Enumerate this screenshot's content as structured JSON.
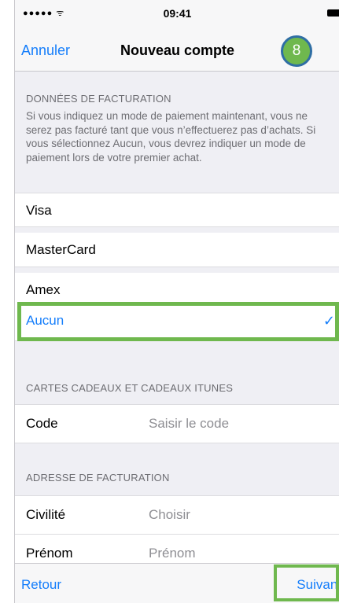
{
  "status_bar": {
    "signal": "●●●●● ᯤ",
    "time": "09:41"
  },
  "nav": {
    "cancel": "Annuler",
    "title": "Nouveau compte",
    "step": "8"
  },
  "billing": {
    "header": "DONNÉES DE FACTURATION",
    "description": "Si vous indiquez un mode de paiement maintenant, vous ne serez pas facturé tant que vous n’effectuerez pas d’achats. Si vous sélectionnez Aucun, vous devrez indiquer un mode de paiement lors de votre premier achat.",
    "options": [
      {
        "label": "Visa"
      },
      {
        "label": "MasterCard"
      },
      {
        "label": "Amex"
      },
      {
        "label": "Aucun",
        "selected": true
      }
    ],
    "checkmark": "✓"
  },
  "gift": {
    "header": "CARTES CADEAUX ET CADEAUX ITUNES",
    "code_label": "Code",
    "code_placeholder": "Saisir le code"
  },
  "address": {
    "header": "ADRESSE DE FACTURATION",
    "rows": [
      {
        "label": "Civilité",
        "placeholder": "Choisir"
      },
      {
        "label": "Prénom",
        "placeholder": "Prénom"
      }
    ]
  },
  "toolbar": {
    "back": "Retour",
    "next": "Suivant"
  },
  "colors": {
    "accent": "#157efb",
    "highlight": "#6fb84e",
    "background": "#efeff4"
  }
}
